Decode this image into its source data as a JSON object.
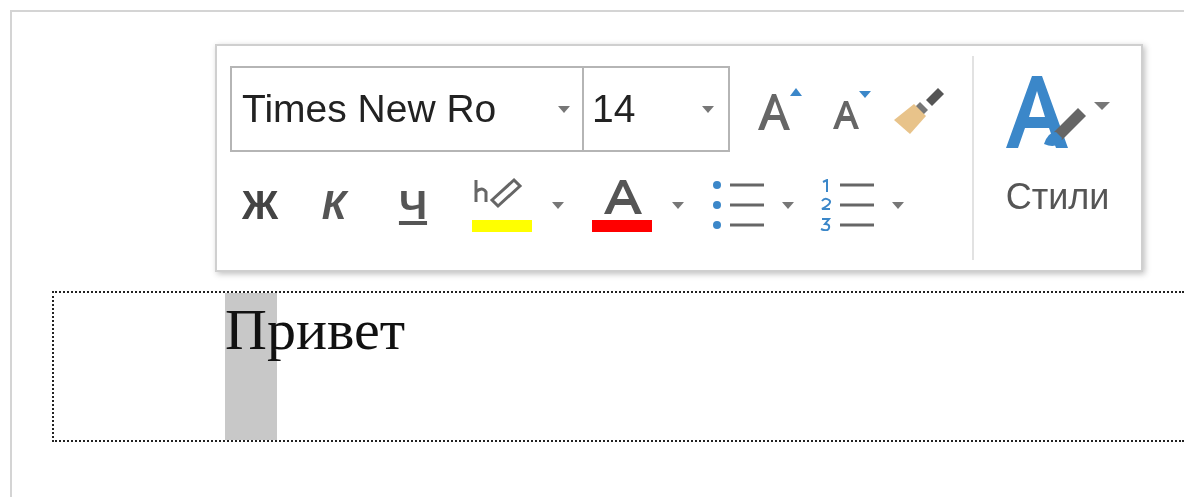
{
  "mini_toolbar": {
    "font_name": {
      "value": "Times New Ro"
    },
    "font_size": {
      "value": "14"
    },
    "format_buttons": [
      {
        "kind": "bold",
        "label": "Ж"
      },
      {
        "kind": "italic",
        "label": "К"
      },
      {
        "kind": "underline",
        "label": "Ч"
      }
    ],
    "color_buttons": [
      {
        "kind": "highlight",
        "color": "#ffff00"
      },
      {
        "kind": "font-color",
        "color": "#ff0000"
      }
    ],
    "styles_button": {
      "label": "Стили"
    }
  },
  "document": {
    "text": "Привет"
  }
}
